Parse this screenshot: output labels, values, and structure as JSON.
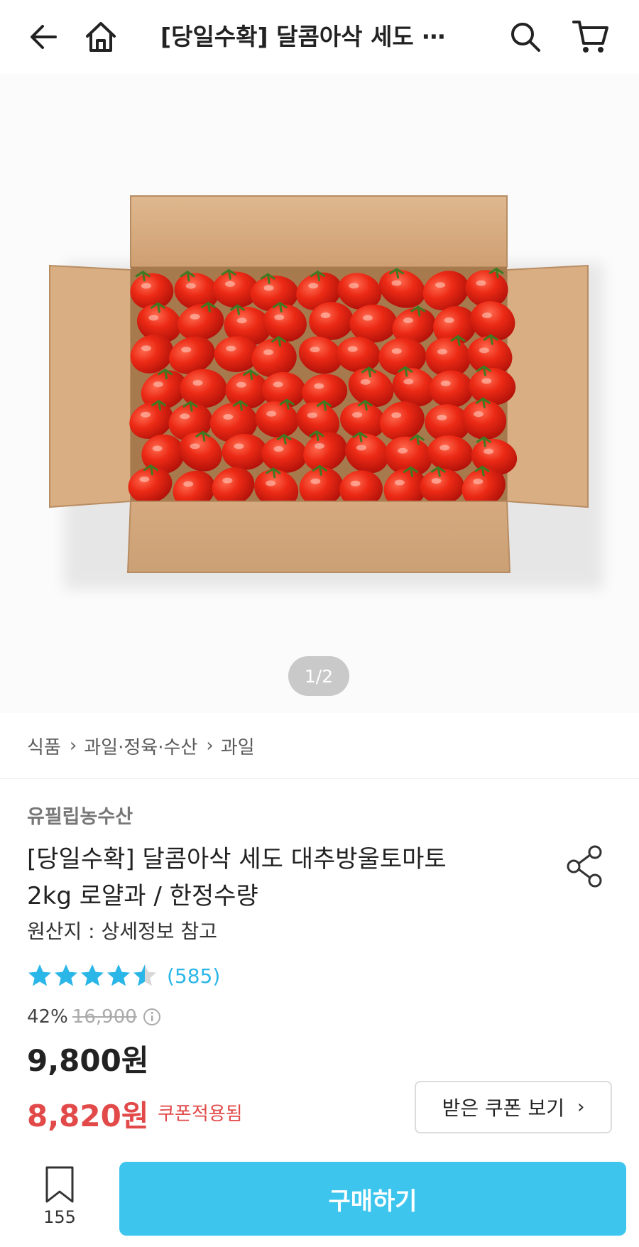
{
  "header": {
    "title": "[당일수확] 달콤아삭 세도 ⋯",
    "back_icon": "arrow-left-icon",
    "home_icon": "home-icon",
    "search_icon": "search-icon",
    "cart_icon": "cart-icon"
  },
  "gallery": {
    "image_name": "cherry-tomato-box-image",
    "page_indicator": "1/2"
  },
  "breadcrumb": {
    "items": [
      "식품",
      "과일·정육·수산",
      "과일"
    ]
  },
  "product": {
    "seller": "유필립농수산",
    "title_line1": "[당일수확] 달콤아삭 세도 대추방울토마토",
    "title_line2": "2kg 로얄과 / 한정수량",
    "origin": "원산지 : 상세정보 참고",
    "rating": 4.5,
    "review_count": "(585)",
    "discount_rate": "42%",
    "original_price": "16,900",
    "price": "9,800원",
    "coupon_price": "8,820원",
    "coupon_label": "쿠폰적용됨",
    "coupon_button_label": "받은 쿠폰 보기"
  },
  "bottom_bar": {
    "wishlist_count": "155",
    "buy_label": "구매하기"
  },
  "colors": {
    "accent_blue": "#3ec5ee",
    "star_blue": "#2bb6e8",
    "sale_red": "#e24a4a"
  }
}
